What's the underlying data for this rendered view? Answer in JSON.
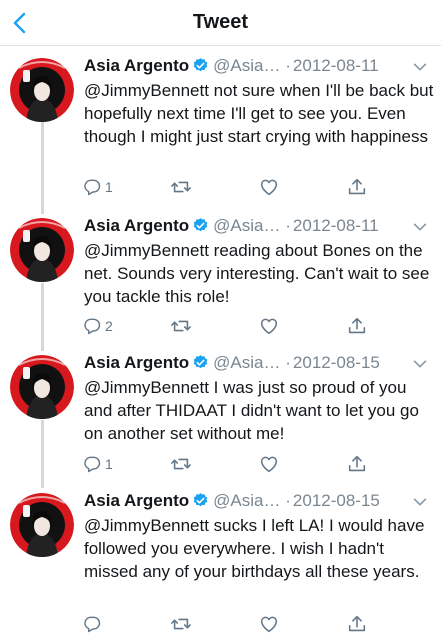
{
  "header": {
    "title": "Tweet"
  },
  "colors": {
    "accent": "#1da1f2",
    "text": "#14171a",
    "muted": "#7a8791"
  },
  "tweets": [
    {
      "name": "Asia Argento",
      "handle": "@Asia…",
      "dot": "·",
      "date": "2012-08-11",
      "text": "@JimmyBennett not sure when I'll be back but hopefully next time I'll get to see you. Even though I might just start crying with happiness",
      "reply_count": "1"
    },
    {
      "name": "Asia Argento",
      "handle": "@Asia…",
      "dot": "·",
      "date": "2012-08-11",
      "text": "@JimmyBennett reading about Bones on the net. Sounds very interesting. Can't wait to see you tackle this role!",
      "reply_count": "2"
    },
    {
      "name": "Asia Argento",
      "handle": "@Asia…",
      "dot": "·",
      "date": "2012-08-15",
      "text": "@JimmyBennett I was just so proud of you and after THIDAAT I didn't want to let you go on another set without me!",
      "reply_count": "1"
    },
    {
      "name": "Asia Argento",
      "handle": "@Asia…",
      "dot": "·",
      "date": "2012-08-15",
      "text": "@JimmyBennett sucks I left LA! I would have followed you everywhere. I wish I hadn't missed any of your birthdays all these years.",
      "reply_count": ""
    }
  ]
}
